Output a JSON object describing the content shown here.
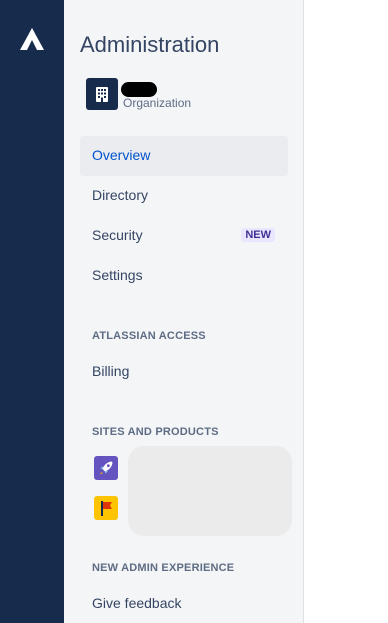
{
  "global_nav": {
    "logo_icon": "atlassian-logo-icon",
    "background": "#172b4d"
  },
  "sidebar": {
    "title": "Administration",
    "org": {
      "icon": "building-icon",
      "label": "Organization"
    },
    "items": [
      {
        "label": "Overview",
        "active": true
      },
      {
        "label": "Directory"
      },
      {
        "label": "Security",
        "badge": "NEW"
      },
      {
        "label": "Settings"
      }
    ],
    "sections": {
      "access_heading": "ATLASSIAN ACCESS",
      "billing_label": "Billing",
      "sites_heading": "SITES AND PRODUCTS",
      "new_admin_heading": "NEW ADMIN EXPERIENCE",
      "give_feedback_label": "Give feedback"
    },
    "products": [
      {
        "icon": "rocket-icon",
        "color": "#6554c0"
      },
      {
        "icon": "flag-icon",
        "color": "#ffc400"
      }
    ]
  },
  "colors": {
    "accent": "#0052cc",
    "text": "#344563",
    "muted": "#5e6c84",
    "active_bg": "#ebecf0",
    "badge_bg": "#eae6ff",
    "badge_text": "#403294"
  }
}
